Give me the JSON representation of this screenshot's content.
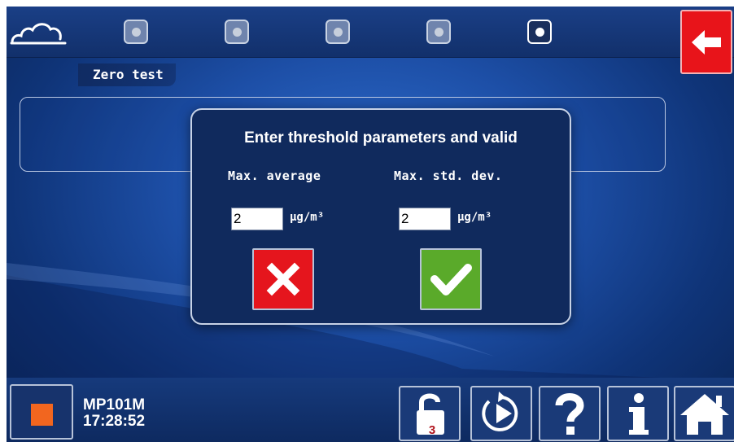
{
  "header": {
    "logo_icon": "cloud-logo-icon",
    "steps": [
      "step-1",
      "step-2",
      "step-3",
      "step-4",
      "step-5"
    ],
    "active_step": 5,
    "back_icon": "arrow-left-icon",
    "section_label": "Zero test"
  },
  "dialog": {
    "title": "Enter threshold parameters and valid",
    "fields": [
      {
        "label": "Max. average",
        "value": "2",
        "unit": "µg/m³"
      },
      {
        "label": "Max. std. dev.",
        "value": "2",
        "unit": "µg/m³"
      }
    ],
    "cancel_icon": "close-icon",
    "confirm_icon": "checkmark-icon"
  },
  "footer": {
    "stop_icon": "stop-icon",
    "device_name": "MP101M",
    "time": "17:28:52",
    "lock_level": "3",
    "nav_icons": [
      "unlock-icon",
      "play-icon",
      "help-icon",
      "info-icon",
      "home-icon"
    ]
  },
  "colors": {
    "accent_red": "#e8141a",
    "accent_green": "#5aaa2a",
    "stop_orange": "#f2661f",
    "panel_blue": "#102a5d"
  }
}
